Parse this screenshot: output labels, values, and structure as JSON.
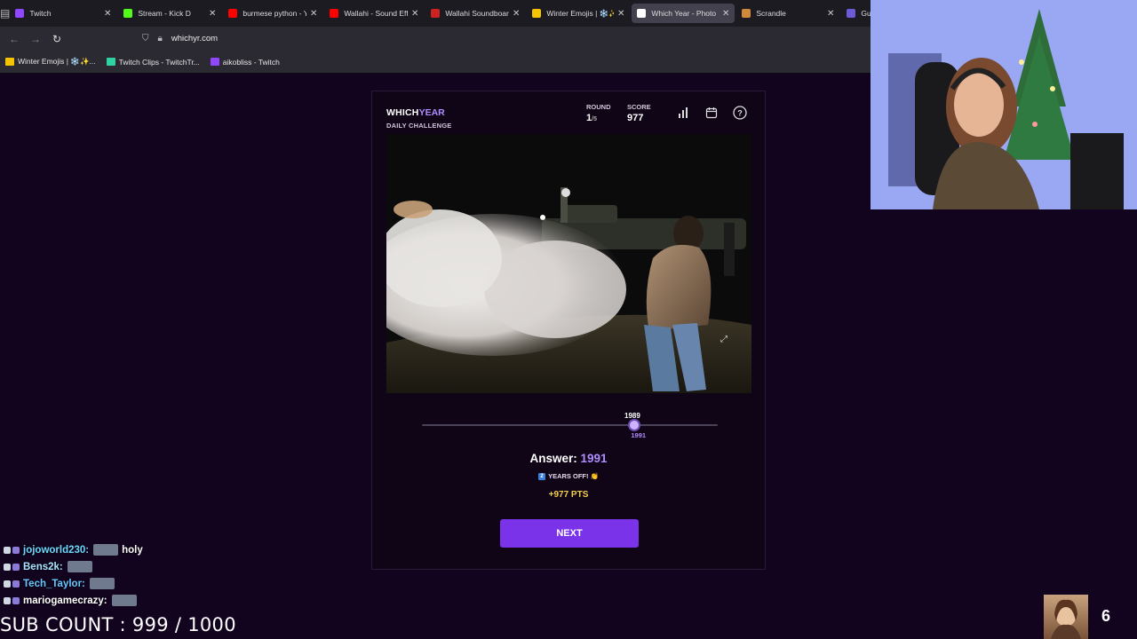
{
  "browser": {
    "tabs": [
      {
        "label": "Twitch",
        "color": "#9146ff",
        "active": false,
        "width": 108
      },
      {
        "label": "Stream - Kick D",
        "color": "#53fc18",
        "active": false,
        "width": 104
      },
      {
        "label": "burmese python - Y",
        "color": "#ff0000",
        "active": false,
        "width": 100
      },
      {
        "label": "Wallahi - Sound Eff",
        "color": "#ff0000",
        "active": false,
        "width": 100
      },
      {
        "label": "Wallahi Soundboar",
        "color": "#cc2222",
        "active": false,
        "width": 100
      },
      {
        "label": "Winter Emojis | ❄️✨",
        "color": "#f5c400",
        "active": false,
        "width": 104
      },
      {
        "label": "Which Year - Photo",
        "color": "#ffffff",
        "active": true,
        "width": 104
      },
      {
        "label": "Scrandle",
        "color": "#d08a3a",
        "active": false,
        "width": 104
      },
      {
        "label": "Guess The.Game #",
        "color": "#6b5bd6",
        "active": false,
        "width": 96
      }
    ],
    "url": "whichyr.com",
    "bookmarks": [
      {
        "label": "Winter Emojis | ❄️✨...",
        "color": "#f5c400"
      },
      {
        "label": "Twitch Clips - TwitchTr...",
        "color": "#2fd2a0"
      },
      {
        "label": "aikobliss - Twitch",
        "color": "#9146ff"
      }
    ]
  },
  "game": {
    "brand_a": "WHICH",
    "brand_b": "YEAR",
    "mode": "DAILY CHALLENGE",
    "round_label": "ROUND",
    "round_value": "1",
    "round_total": "/5",
    "score_label": "SCORE",
    "score_value": "977",
    "guess_year": "1989",
    "answer_year_tick": "1991",
    "slider": {
      "min_year": 1900,
      "max_year": 2024,
      "guess": 1989,
      "answer": 1991
    },
    "answer_label": "Answer:",
    "answer_year": "1991",
    "years_off_badge": "2",
    "years_off_text": "YEARS OFF! 👏",
    "points": "+977 PTS",
    "next_label": "NEXT"
  },
  "stream": {
    "chat": [
      {
        "user": "jojoworld230:",
        "msg": "holy",
        "color": "#6fd8ff",
        "emote": true
      },
      {
        "user": "Bens2k:",
        "msg": "",
        "color": "#a6e3ff",
        "emote": true
      },
      {
        "user": "Tech_Taylor:",
        "msg": "",
        "color": "#66c8ff",
        "emote": true
      },
      {
        "user": "mariogamecrazy:",
        "msg": "",
        "color": "#ffffff",
        "emote": true
      }
    ],
    "sub_count": "SUB COUNT : 999 / 1000",
    "counter": "6"
  },
  "colors": {
    "accent": "#7a33e8",
    "accent_light": "#b18cff",
    "points": "#f4cf4f",
    "background": "#12041f"
  }
}
